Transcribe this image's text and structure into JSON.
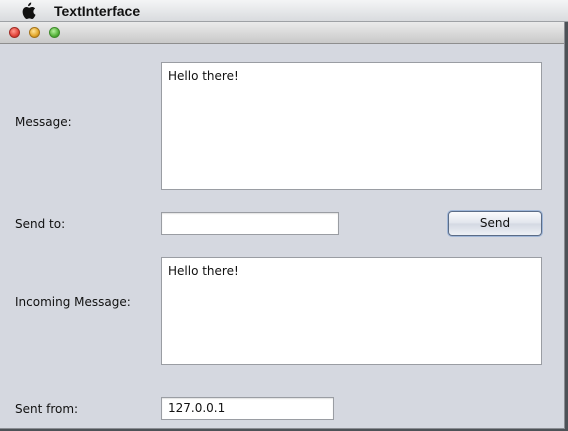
{
  "menubar": {
    "app_name": "TextInterface",
    "apple_icon": "apple-logo-icon"
  },
  "window": {
    "controls": [
      "close-icon",
      "minimize-icon",
      "zoom-icon"
    ]
  },
  "form": {
    "message_label": "Message:",
    "message_value": "Hello there!",
    "send_to_label": "Send to:",
    "send_to_value": "",
    "send_button_label": "Send",
    "incoming_label": "Incoming Message:",
    "incoming_value": "Hello there!",
    "sent_from_label": "Sent from:",
    "sent_from_value": "127.0.0.1"
  },
  "colors": {
    "window_bg": "#d5d8e0",
    "field_bg": "#ffffff",
    "button_border": "#5b6c87"
  }
}
